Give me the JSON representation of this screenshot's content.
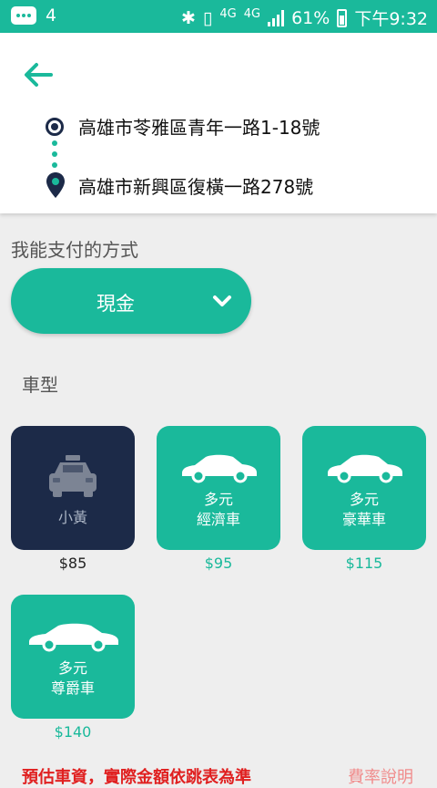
{
  "status_bar": {
    "notification_count": "4",
    "network_1": "4G",
    "network_2": "4G",
    "battery_percent": "61%",
    "time": "下午9:32"
  },
  "route": {
    "origin": "高雄市苓雅區青年一路1-18號",
    "destination": "高雄市新興區復橫一路278號"
  },
  "payment": {
    "section_label": "我能支付的方式",
    "selected": "現金"
  },
  "vehicle": {
    "section_label": "車型",
    "options": [
      {
        "name": "小黃",
        "price": "$85",
        "selected": true
      },
      {
        "name_line1": "多元",
        "name_line2": "經濟車",
        "price": "$95",
        "selected": false
      },
      {
        "name_line1": "多元",
        "name_line2": "豪華車",
        "price": "$115",
        "selected": false
      },
      {
        "name_line1": "多元",
        "name_line2": "尊爵車",
        "price": "$140",
        "selected": false
      }
    ]
  },
  "footer": {
    "notice": "預估車資，實際金額依跳表為準",
    "fare_link": "費率說明"
  },
  "colors": {
    "accent": "#1ab99b",
    "selected_card": "#1c2a48",
    "notice_red": "#e02020"
  }
}
